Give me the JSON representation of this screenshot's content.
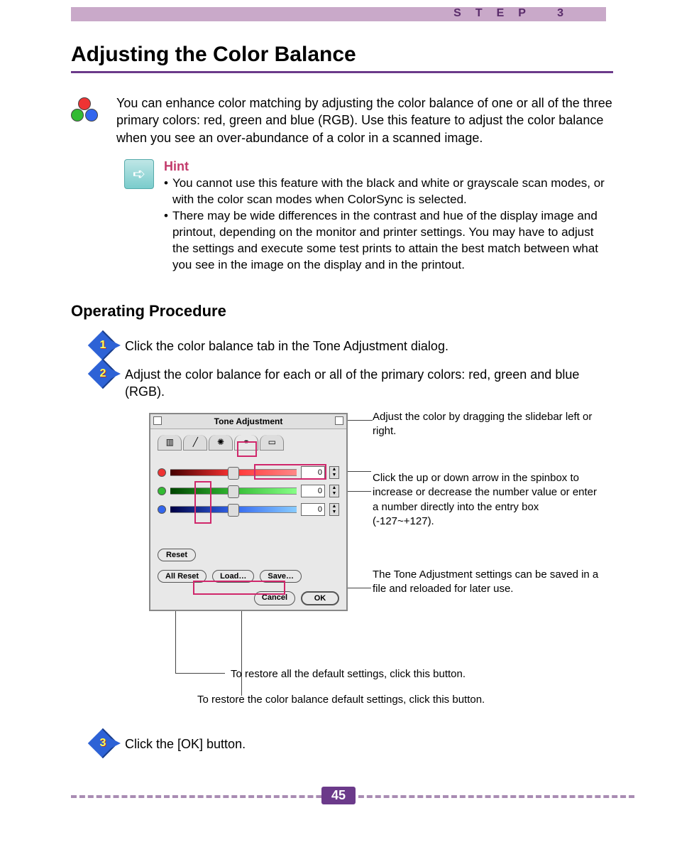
{
  "header": {
    "step_label": "STEP 3"
  },
  "title": "Adjusting the Color Balance",
  "intro": "You can enhance color matching by adjusting the color balance of one or all of the three primary colors: red, green and blue (RGB). Use this feature to adjust the color balance when you see an over-abundance of a color in a scanned image.",
  "hint": {
    "title": "Hint",
    "bullets": [
      "You cannot use this feature with the black and white or grayscale scan modes, or with the color scan modes when ColorSync is selected.",
      "There may be wide differences in the contrast and hue of the display image and printout, depending on the monitor and printer settings. You may have to adjust the settings and execute some test prints to attain the best match between what you see in the image on the display and in the printout."
    ]
  },
  "section_title": "Operating Procedure",
  "steps": [
    {
      "num": "1",
      "text": "Click the color balance tab in the Tone Adjustment dialog."
    },
    {
      "num": "2",
      "text": "Adjust the color balance for each or all of the primary colors: red, green and blue (RGB)."
    },
    {
      "num": "3",
      "text": "Click the [OK] button."
    }
  ],
  "dialog": {
    "title": "Tone Adjustment",
    "slider_values": {
      "red": "0",
      "green": "0",
      "blue": "0"
    },
    "buttons": {
      "reset": "Reset",
      "all_reset": "All Reset",
      "load": "Load…",
      "save": "Save…",
      "cancel": "Cancel",
      "ok": "OK"
    }
  },
  "callouts": {
    "slidebar": "Adjust the color by dragging the slidebar left or right.",
    "spinbox": "Click the up or down arrow in the spinbox to increase or decrease the number value or enter a number directly into the entry box (-127~+127).",
    "saveload": "The Tone Adjustment settings can be saved in a file and reloaded for later use.",
    "allreset": "To restore all the default settings, click this button.",
    "reset": "To restore the color balance default settings, click this button."
  },
  "page_number": "45"
}
